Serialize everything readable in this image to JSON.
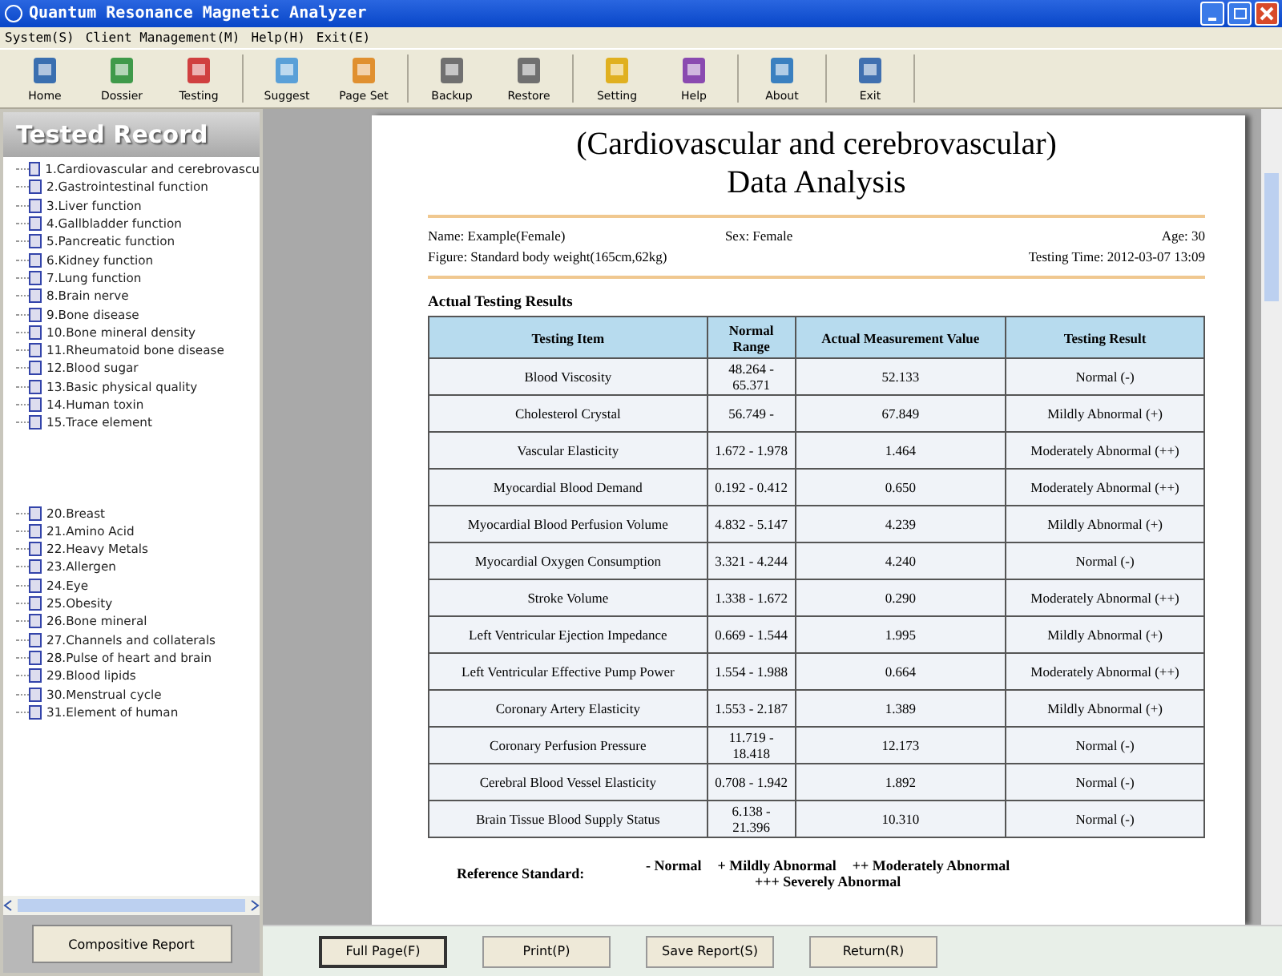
{
  "window": {
    "title": "Quantum Resonance Magnetic Analyzer"
  },
  "menu": [
    "System(S)",
    "Client Management(M)",
    "Help(H)",
    "Exit(E)"
  ],
  "toolbar": [
    "Home",
    "Dossier",
    "Testing",
    "Suggest",
    "Page Set",
    "Backup",
    "Restore",
    "Setting",
    "Help",
    "About",
    "Exit"
  ],
  "sidebar": {
    "title": "Tested Record",
    "items": [
      "1.Cardiovascular and cerebrovascu",
      "2.Gastrointestinal function",
      "3.Liver function",
      "4.Gallbladder function",
      "5.Pancreatic function",
      "6.Kidney function",
      "7.Lung function",
      "8.Brain nerve",
      "9.Bone disease",
      "10.Bone mineral density",
      "11.Rheumatoid bone disease",
      "12.Blood sugar",
      "13.Basic physical quality",
      "14.Human toxin",
      "15.Trace element",
      "20.Breast",
      "21.Amino Acid",
      "22.Heavy Metals",
      "23.Allergen",
      "24.Eye",
      "25.Obesity",
      "26.Bone mineral",
      "27.Channels and collaterals",
      "28.Pulse of heart and brain",
      "29.Blood lipids",
      "30.Menstrual cycle",
      "31.Element of human"
    ],
    "button": "Compositive Report"
  },
  "report": {
    "title": "(Cardiovascular and cerebrovascular)",
    "subtitle": "Data Analysis",
    "name": "Name: Example(Female)",
    "sex": "Sex: Female",
    "age": "Age: 30",
    "figure": "Figure: Standard body weight(165cm,62kg)",
    "time": "Testing Time: 2012-03-07 13:09",
    "section": "Actual Testing Results",
    "columns": [
      "Testing Item",
      "Normal Range",
      "Actual Measurement Value",
      "Testing Result"
    ],
    "rows": [
      [
        "Blood Viscosity",
        "48.264 - 65.371",
        "52.133",
        "Normal (-)"
      ],
      [
        "Cholesterol Crystal",
        "56.749 -",
        "67.849",
        "Mildly Abnormal (+)"
      ],
      [
        "Vascular Elasticity",
        "1.672 - 1.978",
        "1.464",
        "Moderately Abnormal (++)"
      ],
      [
        "Myocardial Blood Demand",
        "0.192 - 0.412",
        "0.650",
        "Moderately Abnormal (++)"
      ],
      [
        "Myocardial Blood Perfusion Volume",
        "4.832 - 5.147",
        "4.239",
        "Mildly Abnormal (+)"
      ],
      [
        "Myocardial Oxygen Consumption",
        "3.321 - 4.244",
        "4.240",
        "Normal (-)"
      ],
      [
        "Stroke Volume",
        "1.338 - 1.672",
        "0.290",
        "Moderately Abnormal (++)"
      ],
      [
        "Left Ventricular Ejection Impedance",
        "0.669 - 1.544",
        "1.995",
        "Mildly Abnormal (+)"
      ],
      [
        "Left Ventricular Effective Pump Power",
        "1.554 - 1.988",
        "0.664",
        "Moderately Abnormal (++)"
      ],
      [
        "Coronary Artery Elasticity",
        "1.553 - 2.187",
        "1.389",
        "Mildly Abnormal (+)"
      ],
      [
        "Coronary Perfusion Pressure",
        "11.719 - 18.418",
        "12.173",
        "Normal (-)"
      ],
      [
        "Cerebral Blood Vessel Elasticity",
        "0.708 - 1.942",
        "1.892",
        "Normal (-)"
      ],
      [
        "Brain Tissue Blood Supply Status",
        "6.138 - 21.396",
        "10.310",
        "Normal (-)"
      ]
    ],
    "reference_label": "Reference Standard:",
    "reference": [
      "- Normal",
      "+ Mildly Abnormal",
      "++ Moderately Abnormal",
      "+++ Severely Abnormal"
    ]
  },
  "buttons": [
    "Full Page(F)",
    "Print(P)",
    "Save Report(S)",
    "Return(R)"
  ]
}
